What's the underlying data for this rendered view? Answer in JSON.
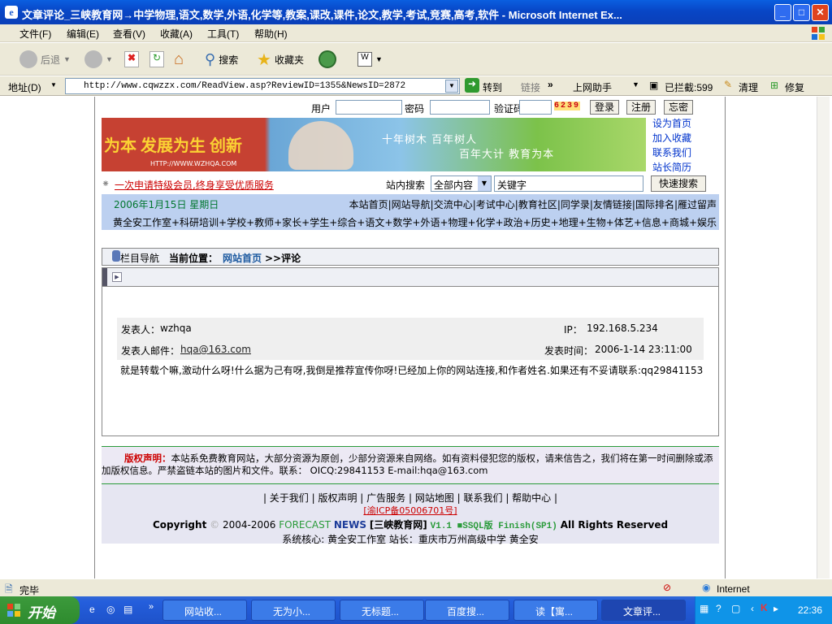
{
  "window": {
    "title": "文章评论_三峡教育网→中学物理,语文,数学,外语,化学等,教案,课改,课件,论文,教学,考试,竞赛,高考,软件 - Microsoft Internet Ex..."
  },
  "menu": [
    "文件(F)",
    "编辑(E)",
    "查看(V)",
    "收藏(A)",
    "工具(T)",
    "帮助(H)"
  ],
  "toolbar": {
    "back": "后退",
    "search": "搜索",
    "favorites": "收藏夹"
  },
  "address": {
    "label": "地址(D)",
    "url": "http://www.cqwzzx.com/ReadView.asp?ReviewID=1355&NewsID=2872",
    "go": "转到",
    "links": "链接",
    "helper": "上网助手",
    "blocked": "已拦截:599",
    "clean": "清理",
    "repair": "修复"
  },
  "login": {
    "user": "用户",
    "pass": "密码",
    "code": "验证码",
    "captcha": "6239",
    "login": "登录",
    "register": "注册",
    "forgot": "忘密"
  },
  "banner": {
    "slogan1": "十年树木  百年树人",
    "slogan2": "百年大计  教育为本",
    "left": "为本  发展为生  创新",
    "url": "HTTP://WWW.WZHQA.COM"
  },
  "side": [
    "设为首页",
    "加入收藏",
    "联系我们",
    "站长简历"
  ],
  "promo": "一次申请特级会员,终身享受优质服务",
  "search": {
    "label": "站内搜索",
    "option": "全部内容",
    "keyword": "关键字",
    "button": "快速搜索"
  },
  "date": "2006年1月15日 星期日",
  "toplinks": "本站首页|网站导航|交流中心|考试中心|教育社区|同学录|友情链接|国际排名|雁过留声",
  "cats": "黄全安工作室+科研培训+学校+教师+家长+学生+综合+语文+数学+外语+物理+化学+政治+历史+地理+生物+体艺+信息+商城+娱乐",
  "crumb": {
    "nav": "栏目导航",
    "pos": "当前位置：",
    "home": "网站首页",
    "tail": ">>评论"
  },
  "comment": {
    "author_label": "发表人：",
    "author": "wzhqa",
    "ip_label": "IP：",
    "ip": "192.168.5.234",
    "email_label": "发表人邮件：",
    "email": "hqa@163.com",
    "time_label": "发表时间：",
    "time": "2006-1-14 23:11:00",
    "text": "就是转载个嘛,激动什么呀!什么据为己有呀,我倒是推荐宣传你呀!已经加上你的网站连接,和作者姓名.如果还有不妥请联系:qq29841153"
  },
  "footer": {
    "copy_title": "版权声明：",
    "copy_text": "本站系免费教育网站，大部分资源为原创，少部分资源来自网络。如有资料侵犯您的版权，请来信告之，我们将在第一时间删除或添加版权信息。严禁盗链本站的图片和文件。联系：  OICQ:29841153     E-mail:hqa@163.com",
    "links": "| 关于我们 | 版权声明 | 广告服务 | 网站地图 | 联系我们 | 帮助中心 |",
    "icp": "[渝ICP备05006701号]",
    "copyright": "Copyright",
    "years": "2004-2006",
    "forecast": "FORECAST",
    "news": "NEWS",
    "site": "[三峡教育网]",
    "version": "V1.1 ■SSQL版 Finish(SP1)",
    "rights": "All Rights Reserved",
    "core": "系统核心: 黄全安工作室  站长：重庆市万州高级中学 黄全安"
  },
  "status": {
    "text": "完毕",
    "zone": "Internet"
  },
  "taskbar": {
    "start": "开始",
    "tasks": [
      "网站收...",
      "无为小...",
      "无标题...",
      "百度搜...",
      "读【寓...",
      "文章评..."
    ],
    "clock": "22:36"
  }
}
